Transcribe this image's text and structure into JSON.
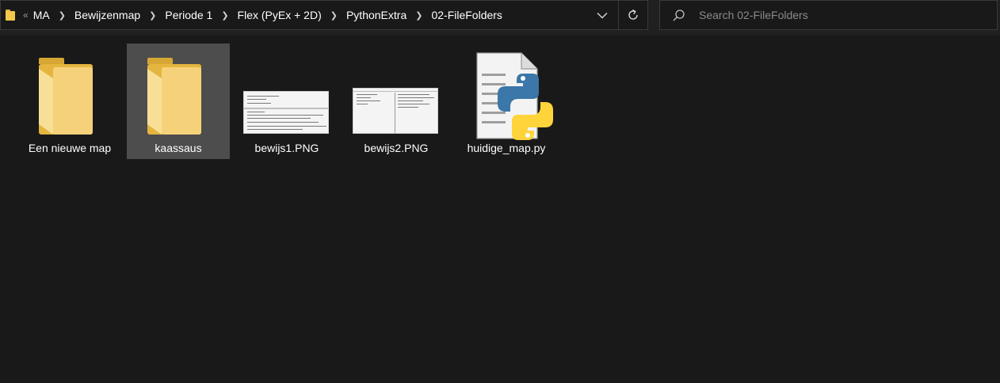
{
  "address_bar": {
    "overflow_glyph": "«",
    "breadcrumbs": [
      "MA",
      "Bewijzenmap",
      "Periode 1",
      "Flex (PyEx + 2D)",
      "PythonExtra",
      "02-FileFolders"
    ]
  },
  "search": {
    "placeholder": "Search 02-FileFolders"
  },
  "files": [
    {
      "name": "Een nieuwe map",
      "type": "folder",
      "selected": false
    },
    {
      "name": "kaassaus",
      "type": "folder",
      "selected": true
    },
    {
      "name": "bewijs1.PNG",
      "type": "image",
      "selected": false
    },
    {
      "name": "bewijs2.PNG",
      "type": "image",
      "selected": false
    },
    {
      "name": "huidige_map.py",
      "type": "python",
      "selected": false
    }
  ],
  "colors": {
    "background": "#191919",
    "selection": "#4d4d4d",
    "folder": "#f2c94c",
    "python_blue": "#3b77a8",
    "python_yellow": "#ffd43b"
  },
  "icons": [
    "folder-icon",
    "chevron-right-icon",
    "chevron-down-icon",
    "refresh-icon",
    "search-icon",
    "python-file-icon"
  ]
}
